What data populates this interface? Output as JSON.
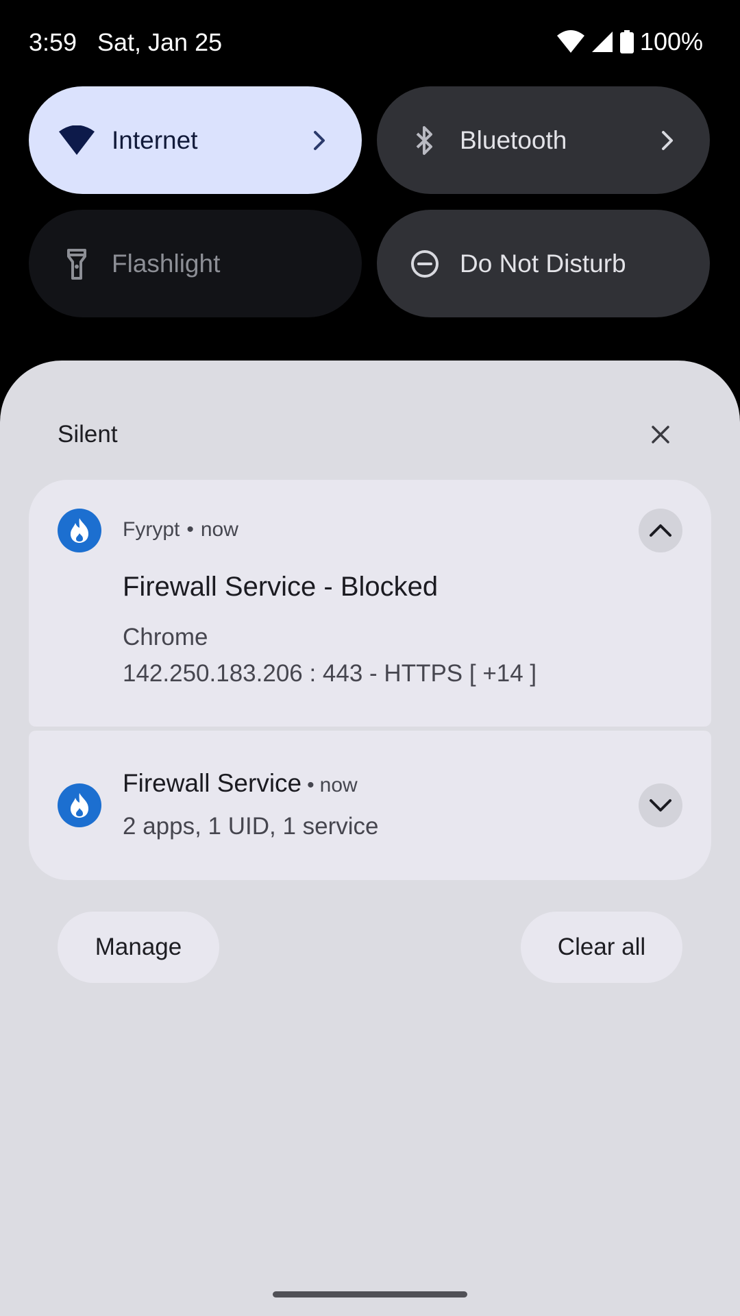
{
  "status_bar": {
    "time": "3:59",
    "date": "Sat, Jan 25",
    "battery": "100%",
    "icons": [
      "wifi-icon",
      "signal-icon",
      "battery-icon"
    ]
  },
  "quick_tiles": {
    "internet": {
      "label": "Internet",
      "icon": "wifi-icon"
    },
    "bluetooth": {
      "label": "Bluetooth",
      "icon": "bluetooth-icon"
    },
    "flashlight": {
      "label": "Flashlight",
      "icon": "flashlight-icon"
    },
    "dnd": {
      "label": "Do Not Disturb",
      "icon": "dnd-icon"
    }
  },
  "shade": {
    "section_label": "Silent",
    "notification_expanded": {
      "app": "Fyrypt",
      "time": "now",
      "title": "Firewall Service - Blocked",
      "line1": "Chrome",
      "line2": "142.250.183.206 : 443 - HTTPS [ +14 ]"
    },
    "notification_collapsed": {
      "title": "Firewall Service",
      "time": "now",
      "subtitle": "2 apps, 1 UID, 1 service"
    },
    "buttons": {
      "manage": "Manage",
      "clear_all": "Clear all"
    }
  },
  "colors": {
    "internet_tile": "#dbe2fd",
    "active_tile": "#303136",
    "inactive_tile": "#121317",
    "shade_bg": "#dcdce2",
    "card_bg": "#e8e7ef",
    "app_icon": "#1c6fd0"
  }
}
